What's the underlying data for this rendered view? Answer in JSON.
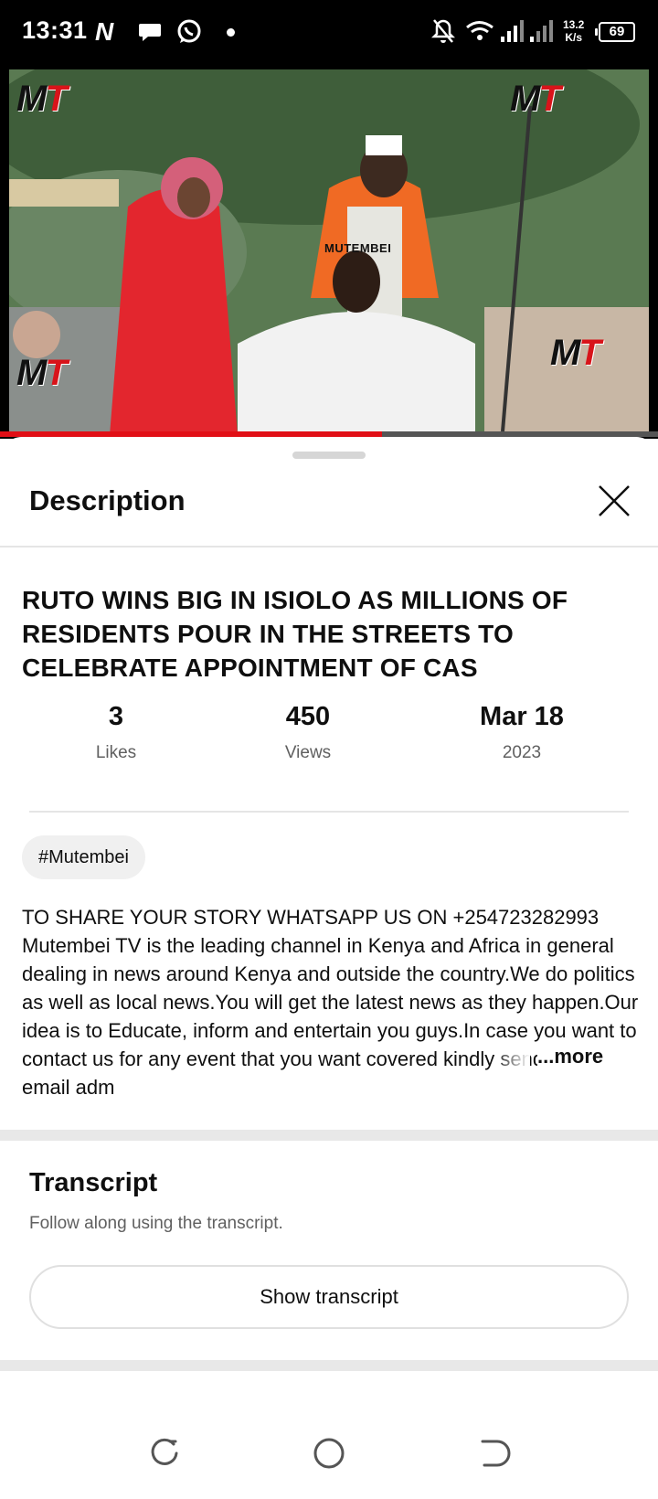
{
  "status_bar": {
    "time": "13:31",
    "n_icon_glyph": "N",
    "net_speed_value": "13.2",
    "net_speed_unit": "K/s",
    "battery": "69",
    "icons": [
      "n-app-icon",
      "chat-bubble-icon",
      "whatsapp-icon",
      "dot-icon",
      "bell-off-icon",
      "wifi-icon",
      "signal-icon",
      "signal-icon"
    ]
  },
  "video": {
    "watermark": "MUTEMBEI",
    "logo_text": "MT",
    "progress": 0.58,
    "accent_color": "#e10f16"
  },
  "sheet": {
    "title": "Description",
    "close_icon": "close-icon"
  },
  "video_info": {
    "title": "RUTO WINS BIG IN ISIOLO AS MILLIONS OF RESIDENTS POUR IN THE STREETS TO CELEBRATE APPOINTMENT OF CAS",
    "stats": [
      {
        "value": "3",
        "label": "Likes"
      },
      {
        "value": "450",
        "label": "Views"
      },
      {
        "value": "Mar 18",
        "label": "2023"
      }
    ],
    "hashtag": "#Mutembei",
    "description": "TO SHARE YOUR STORY WHATSAPP US ON +254723282993 Mutembei TV is the leading channel in Kenya and Africa in general dealing in news around Kenya and outside the country.We do politics as well as local news.You will get the latest news as they happen.Our idea is to Educate, inform and entertain you guys.In case you want to contact us for any event that you want covered kindly send us an email adm",
    "more_label": "...more"
  },
  "transcript": {
    "title": "Transcript",
    "subtitle": "Follow along using the transcript.",
    "button_label": "Show transcript"
  },
  "nav_bar": {
    "icons": [
      "recents-icon",
      "home-circle-icon",
      "back-icon"
    ]
  }
}
